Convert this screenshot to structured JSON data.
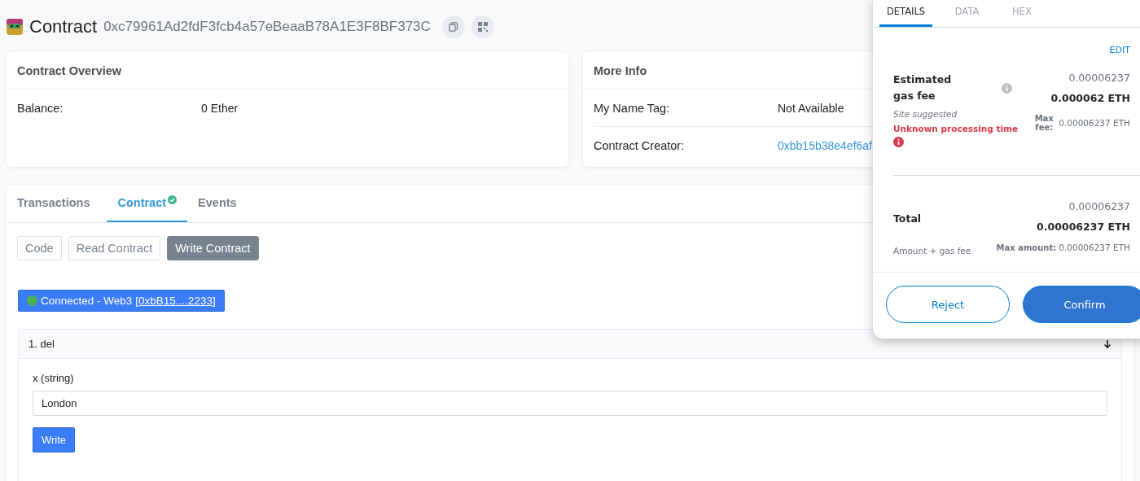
{
  "header": {
    "title": "Contract",
    "address": "0xc79961Ad2fdF3fcb4a57eBeaaB78A1E3F8BF373C"
  },
  "overview": {
    "title": "Contract Overview",
    "rows": [
      {
        "label": "Balance:",
        "value": "0 Ether",
        "kind": "text"
      }
    ]
  },
  "more_info": {
    "title": "More Info",
    "rows": [
      {
        "label": "My Name Tag:",
        "value": "Not Available",
        "kind": "text"
      },
      {
        "label": "Contract Creator:",
        "value": "0xbb15b38e4ef6af",
        "kind": "link"
      }
    ]
  },
  "tabs": [
    {
      "label": "Transactions",
      "selected": false,
      "verified": false
    },
    {
      "label": "Contract",
      "selected": true,
      "verified": true
    },
    {
      "label": "Events",
      "selected": false,
      "verified": false
    }
  ],
  "sub_tabs": [
    {
      "label": "Code",
      "selected": false
    },
    {
      "label": "Read Contract",
      "selected": false
    },
    {
      "label": "Write Contract",
      "selected": true
    }
  ],
  "connection": {
    "status": "Connected - Web3",
    "account": "[0xbB15....2233]",
    "connected": true
  },
  "function": {
    "title": "1. del",
    "expanded": true,
    "input_label": "x (string)",
    "input_value": "London",
    "button": "Write"
  },
  "popup": {
    "tabs": [
      {
        "label": "DETAILS",
        "selected": true
      },
      {
        "label": "DATA",
        "selected": false
      },
      {
        "label": "HEX",
        "selected": false
      }
    ],
    "edit": "EDIT",
    "gas": {
      "label": "Estimated gas fee",
      "amount": "0.00006237",
      "amount_bold": "0.000062 ETH",
      "note": "Site suggested",
      "warning": "Unknown processing time",
      "max_label": "Max fee:",
      "max_value": "0.00006237 ETH"
    },
    "total": {
      "label": "Total",
      "amount": "0.00006237",
      "amount_bold": "0.00006237 ETH",
      "note": "Amount + gas fee",
      "max_label": "Max amount:",
      "max_value": "0.00006237 ETH"
    },
    "buttons": [
      {
        "label": "Reject",
        "kind": "secondary"
      },
      {
        "label": "Confirm",
        "kind": "primary"
      }
    ]
  }
}
